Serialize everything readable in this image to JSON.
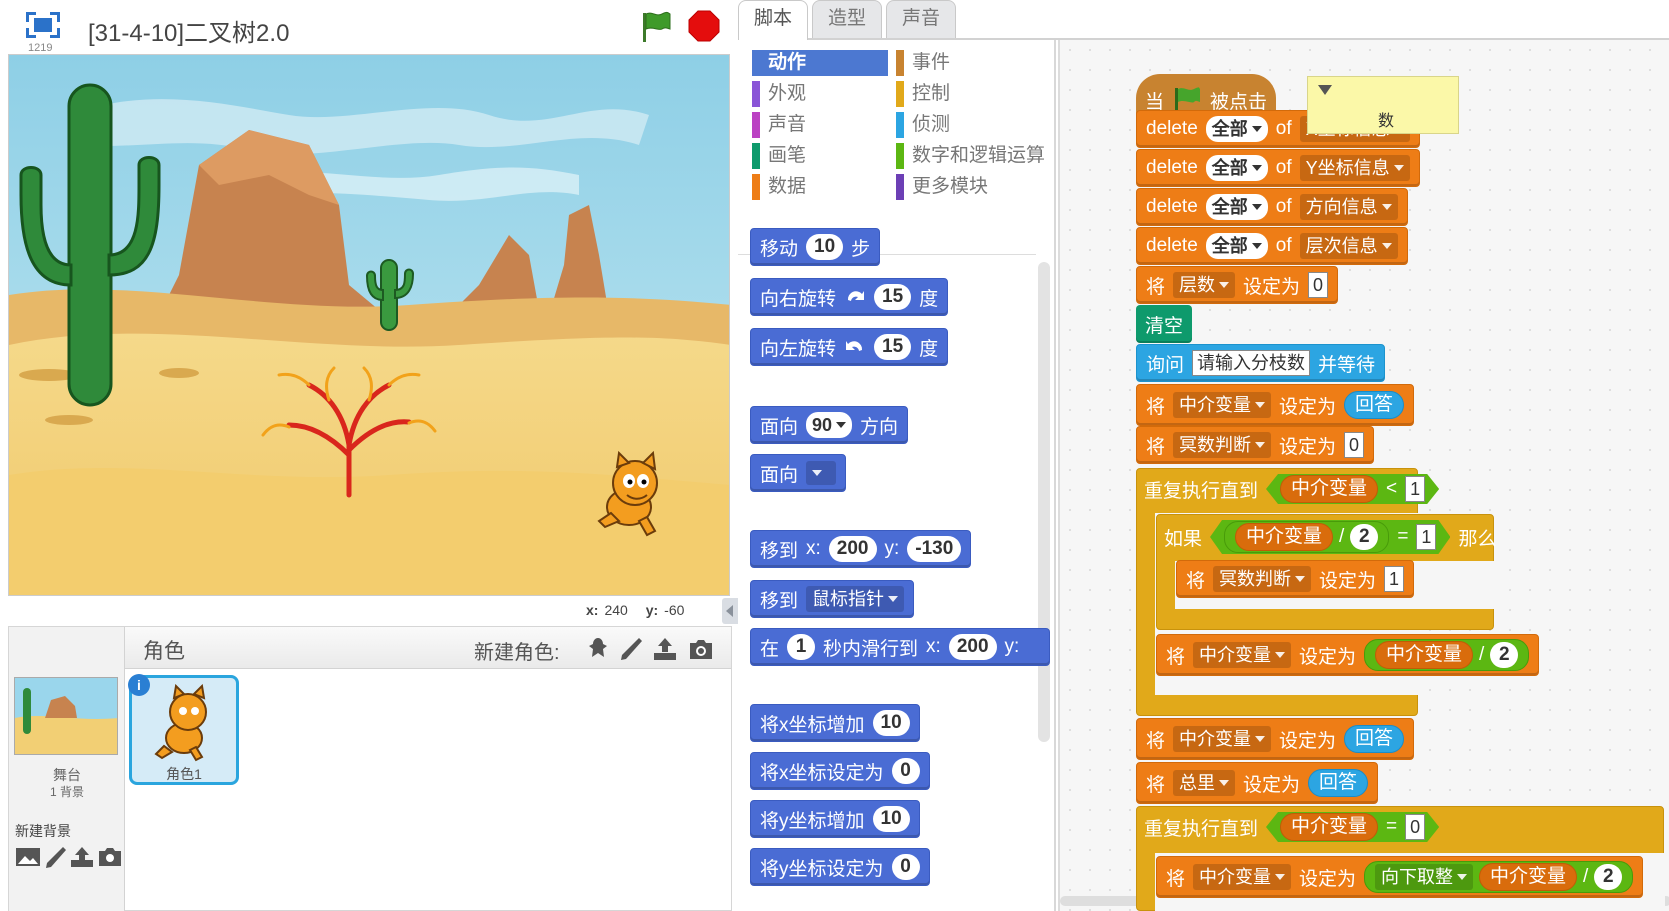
{
  "stage": {
    "version": "1219",
    "project_title": "[31-4-10]二叉树2.0",
    "coords": {
      "x_label": "x:",
      "x_value": "240",
      "y_label": "y:",
      "y_value": "-60"
    }
  },
  "sprites": {
    "header_label": "角色",
    "new_sprite_label": "新建角色:",
    "stage_label": "舞台",
    "stage_backdrops": "1 背景",
    "new_backdrop_label": "新建背景",
    "sprite_name": "角色1"
  },
  "tabs": [
    "脚本",
    "造型",
    "声音"
  ],
  "categories": {
    "left": [
      "动作",
      "外观",
      "声音",
      "画笔",
      "数据"
    ],
    "right": [
      "事件",
      "控制",
      "侦测",
      "数字和逻辑运算",
      "更多模块"
    ]
  },
  "palette": {
    "move": {
      "pre": "移动",
      "val": "10",
      "post": "步"
    },
    "turn_right": {
      "pre": "向右旋转",
      "val": "15",
      "post": "度"
    },
    "turn_left": {
      "pre": "向左旋转",
      "val": "15",
      "post": "度"
    },
    "point_dir": {
      "pre": "面向",
      "val": "90",
      "post": "方向"
    },
    "point_towards": {
      "pre": "面向"
    },
    "goto_xy": {
      "pre": "移到",
      "x_label": "x:",
      "x": "200",
      "y_label": "y:",
      "y": "-130"
    },
    "goto": {
      "pre": "移到",
      "target": "鼠标指针"
    },
    "glide": {
      "pre": "在",
      "secs": "1",
      "mid": "秒内滑行到",
      "x_label": "x:",
      "x": "200",
      "y_label": "y:"
    },
    "change_x": {
      "pre": "将x坐标增加",
      "val": "10"
    },
    "set_x": {
      "pre": "将x坐标设定为",
      "val": "0"
    },
    "change_y": {
      "pre": "将y坐标增加",
      "val": "10"
    },
    "set_y": {
      "pre": "将y坐标设定为",
      "val": "0"
    }
  },
  "script": {
    "hat": {
      "pre": "当",
      "post": "被点击"
    },
    "note_text": "数",
    "deletes": [
      {
        "cmd": "delete",
        "item": "全部",
        "of": "of",
        "list": "X坐标信息"
      },
      {
        "cmd": "delete",
        "item": "全部",
        "of": "of",
        "list": "Y坐标信息"
      },
      {
        "cmd": "delete",
        "item": "全部",
        "of": "of",
        "list": "方向信息"
      },
      {
        "cmd": "delete",
        "item": "全部",
        "of": "of",
        "list": "层次信息"
      }
    ],
    "set_levels": {
      "pre": "将",
      "var": "层数",
      "mid": "设定为",
      "val": "0"
    },
    "clear": "清空",
    "ask": {
      "pre": "询问",
      "question": "请输入分枝数",
      "post": "并等待"
    },
    "set_mid_answer": {
      "pre": "将",
      "var": "中介变量",
      "mid": "设定为",
      "val": "回答"
    },
    "set_pow": {
      "pre": "将",
      "var": "冥数判断",
      "mid": "设定为",
      "val": "0"
    },
    "repeat1": {
      "pre": "重复执行直到",
      "var": "中介变量",
      "op": "<",
      "val": "1"
    },
    "if": {
      "pre": "如果",
      "var": "中介变量",
      "op": "/",
      "div": "2",
      "eq": "=",
      "val": "1",
      "post": "那么"
    },
    "set_pow1": {
      "pre": "将",
      "var": "冥数判断",
      "mid": "设定为",
      "val": "1"
    },
    "set_mid_div": {
      "pre": "将",
      "var": "中介变量",
      "mid": "设定为",
      "rep": "中介变量",
      "op": "/",
      "val": "2"
    },
    "set_mid_answer2": {
      "pre": "将",
      "var": "中介变量",
      "mid": "设定为",
      "val": "回答"
    },
    "set_total": {
      "pre": "将",
      "var": "总里",
      "mid": "设定为",
      "val": "回答"
    },
    "repeat2": {
      "pre": "重复执行直到",
      "var": "中介变量",
      "op": "=",
      "val": "0"
    },
    "set_floor": {
      "pre": "将",
      "var": "中介变量",
      "mid": "设定为",
      "fn": "向下取整",
      "rep": "中介变量",
      "op": "/",
      "val": "2"
    }
  }
}
